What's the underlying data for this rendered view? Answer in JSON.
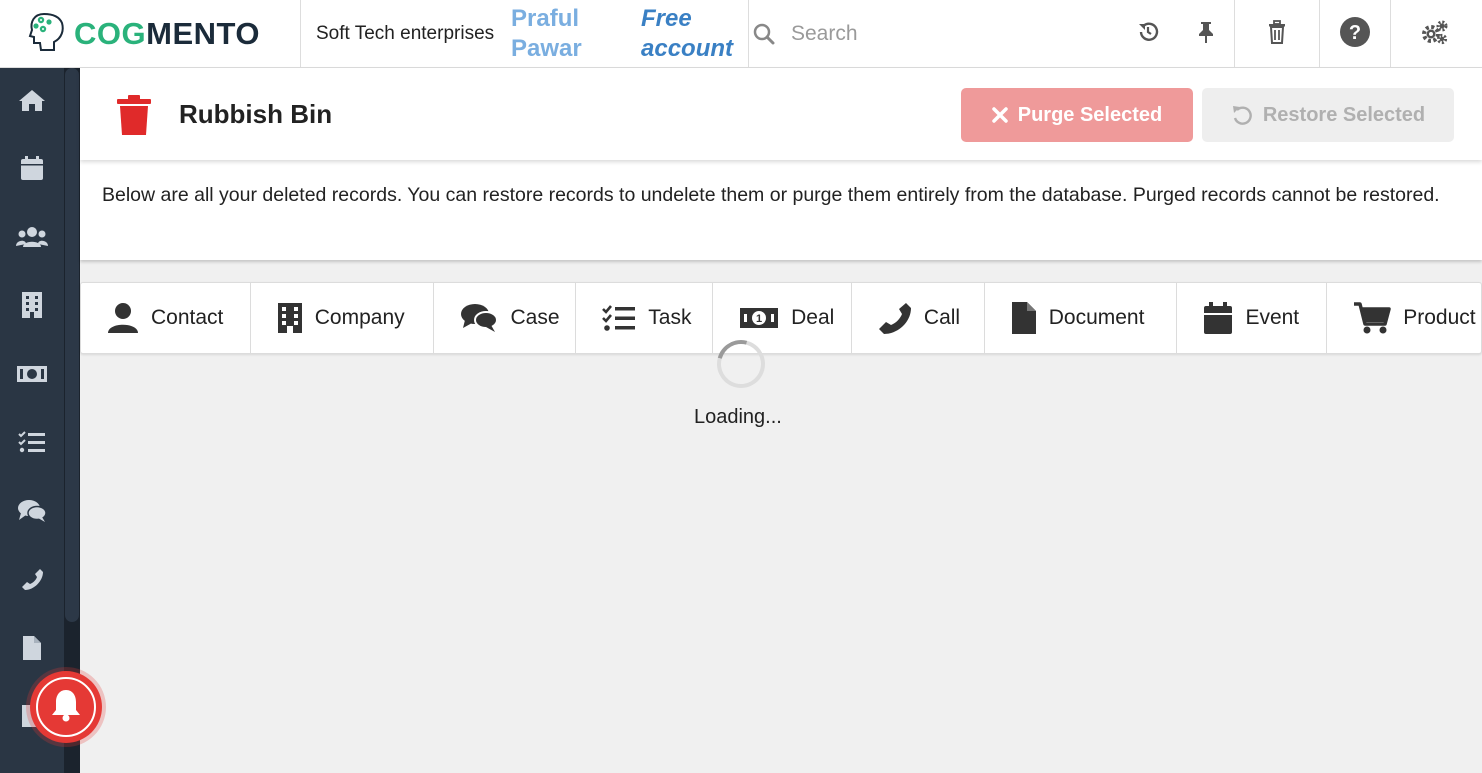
{
  "header": {
    "logo_prefix": "COG",
    "logo_suffix": "MENTO",
    "company": "Soft Tech enterprises",
    "user_name": "Praful Pawar",
    "account_type": "Free account",
    "search_placeholder": "Search",
    "icons": [
      "history-icon",
      "pin-icon",
      "trash-icon",
      "help-icon",
      "settings-icon"
    ]
  },
  "sidebar": {
    "items": [
      "home-icon",
      "calendar-icon",
      "contacts-icon",
      "companies-icon",
      "deals-icon",
      "tasks-icon",
      "cases-icon",
      "calls-icon",
      "documents-icon",
      "email-icon"
    ]
  },
  "page": {
    "title": "Rubbish Bin",
    "purge_label": "Purge Selected",
    "restore_label": "Restore Selected",
    "info": "Below are all your deleted records. You can restore records to undelete them or purge them entirely from the database. Purged records cannot be restored."
  },
  "tabs": [
    {
      "label": "Contact",
      "icon": "user-icon"
    },
    {
      "label": "Company",
      "icon": "building-icon"
    },
    {
      "label": "Case",
      "icon": "comments-icon"
    },
    {
      "label": "Task",
      "icon": "tasks-icon"
    },
    {
      "label": "Deal",
      "icon": "money-icon"
    },
    {
      "label": "Call",
      "icon": "phone-icon"
    },
    {
      "label": "Document",
      "icon": "file-icon"
    },
    {
      "label": "Event",
      "icon": "calendar-icon"
    },
    {
      "label": "Product",
      "icon": "cart-icon"
    }
  ],
  "status": {
    "loading": "Loading..."
  },
  "colors": {
    "brand_green": "#2ab27b",
    "brand_dark": "#1b2b3a",
    "sidebar_bg": "#2a3644",
    "danger": "#e53935",
    "purge_btn": "#ef9a9a"
  }
}
